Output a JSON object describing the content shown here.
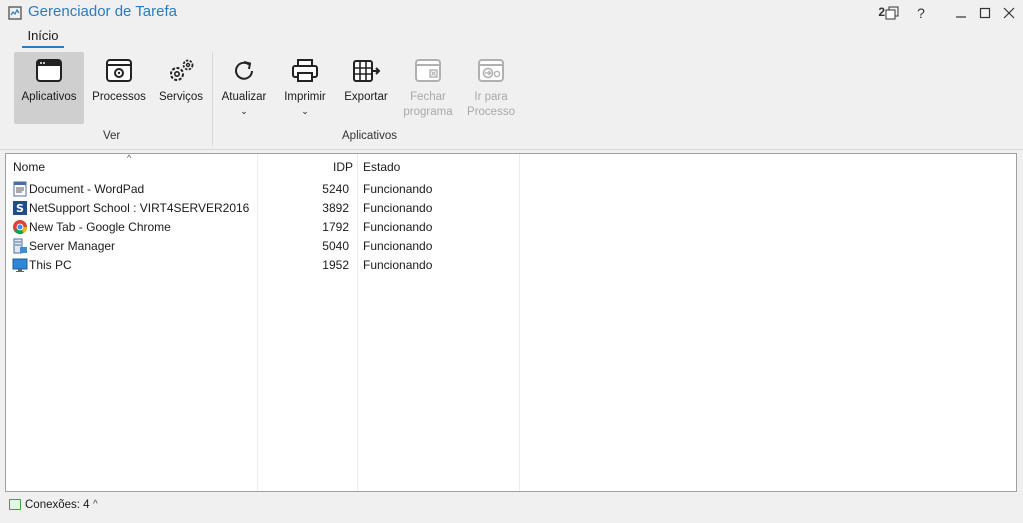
{
  "window": {
    "title": "Gerenciador de Tarefa",
    "session_count": "2",
    "help_label": "?",
    "accent_color": "#2b7bbf"
  },
  "ribbon": {
    "tabs": [
      {
        "label": "Início",
        "active": true
      }
    ],
    "groups": [
      {
        "label": "Ver"
      },
      {
        "label": "Aplicativos"
      }
    ],
    "buttons": {
      "aplicativos": {
        "label": "Aplicativos",
        "icon": "window-icon",
        "selected": true
      },
      "processos": {
        "label": "Processos",
        "icon": "process-gear-icon"
      },
      "servicos": {
        "label": "Serviços",
        "icon": "gears-icon"
      },
      "atualizar": {
        "label": "Atualizar",
        "icon": "refresh-icon",
        "dropdown_caret": "⌄"
      },
      "imprimir": {
        "label": "Imprimir",
        "icon": "printer-icon",
        "dropdown_caret": "⌄"
      },
      "exportar": {
        "label": "Exportar",
        "icon": "export-grid-icon"
      },
      "fechar": {
        "label_line1": "Fechar",
        "label_line2": "programa",
        "icon": "close-window-icon",
        "disabled": true
      },
      "ir_processo": {
        "label_line1": "Ir para",
        "label_line2": "Processo",
        "icon": "goto-process-icon",
        "disabled": true
      }
    }
  },
  "table": {
    "columns": {
      "nome": "Nome",
      "idp": "IDP",
      "estado": "Estado"
    },
    "sort_indicator": "^",
    "rows": [
      {
        "name": "Document - WordPad",
        "idp": "5240",
        "estado": "Funcionando",
        "icon": "wordpad-icon"
      },
      {
        "name": "NetSupport School : VIRT4SERVER2016",
        "idp": "3892",
        "estado": "Funcionando",
        "icon": "netsupport-icon"
      },
      {
        "name": "New Tab - Google Chrome",
        "idp": "1792",
        "estado": "Funcionando",
        "icon": "chrome-icon"
      },
      {
        "name": "Server Manager",
        "idp": "5040",
        "estado": "Funcionando",
        "icon": "server-manager-icon"
      },
      {
        "name": "This PC",
        "idp": "1952",
        "estado": "Funcionando",
        "icon": "monitor-icon"
      }
    ]
  },
  "statusbar": {
    "connections": "Conexões: 4",
    "caret": "^"
  }
}
